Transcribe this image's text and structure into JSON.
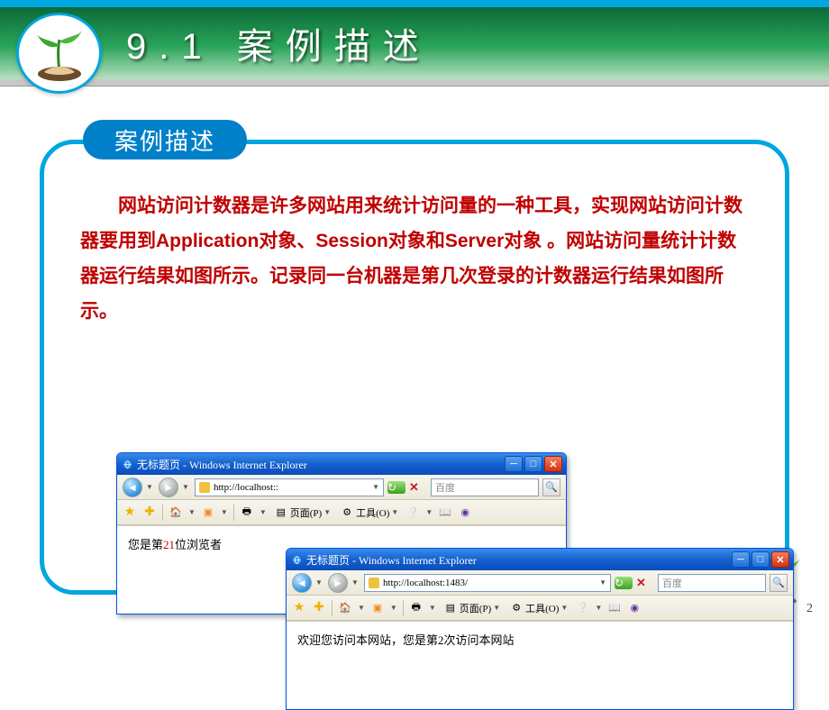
{
  "heading": {
    "title": "9.1 案例描述"
  },
  "pill": {
    "label": "案例描述"
  },
  "body": {
    "paragraph": "网站访问计数器是许多网站用来统计访问量的一种工具，实现网站访问计数器要用到Application对象、Session对象和Server对象 。网站访问量统计计数器运行结果如图所示。记录同一台机器是第几次登录的计数器运行结果如图所示。"
  },
  "ie1": {
    "title": "无标题页 - Windows Internet Explorer",
    "url": "http://localhost::",
    "search_placeholder": "百度",
    "toolbar": {
      "page": "页面(P)",
      "tools": "工具(O)"
    },
    "content_prefix": "您是第",
    "content_count": "21",
    "content_suffix": "位浏览者"
  },
  "ie2": {
    "title": "无标题页 - Windows Internet Explorer",
    "url": "http://localhost:1483/",
    "search_placeholder": "百度",
    "toolbar": {
      "page": "页面(P)",
      "tools": "工具(O)"
    },
    "content": "欢迎您访问本网站，您是第2次访问本网站"
  },
  "page_number": "2"
}
